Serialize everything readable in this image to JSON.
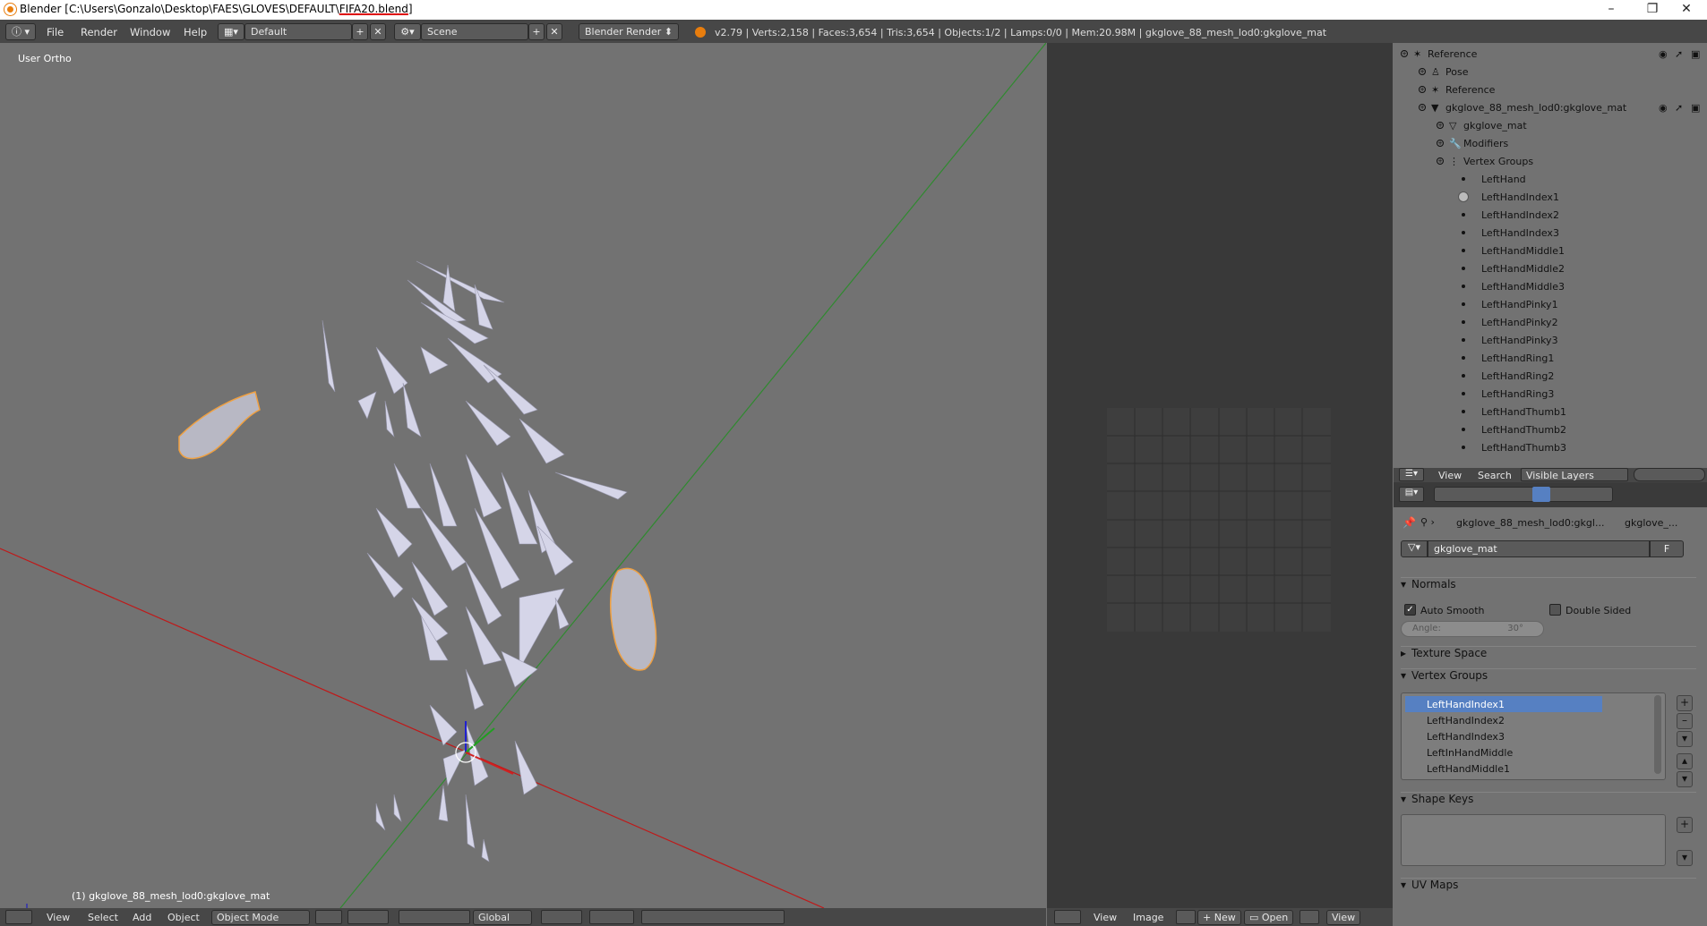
{
  "window": {
    "title_prefix": "Blender [C:\\Users\\Gonzalo\\Desktop\\FAES\\GLOVES\\DEFAULT\\",
    "title_file": "FIFA20.blend",
    "title_suffix": "]",
    "minimize": "–",
    "restore": "❐",
    "close": "✕"
  },
  "menubar": {
    "items": [
      "File",
      "Render",
      "Window",
      "Help"
    ],
    "layout": "Default",
    "scene": "Scene",
    "engine": "Blender Render",
    "stats": "v2.79 | Verts:2,158 | Faces:3,654 | Tris:3,654 | Objects:1/2 | Lamps:0/0 | Mem:20.98M | gkglove_88_mesh_lod0:gkglove_mat"
  },
  "viewport": {
    "view_name": "User Ortho",
    "object_label": "(1) gkglove_88_mesh_lod0:gkglove_mat",
    "axis_x": "X",
    "axis_y": "Y",
    "axis_z": "Z"
  },
  "outliner": {
    "rows": [
      {
        "label": "Reference",
        "indent": 0,
        "kind": "armature"
      },
      {
        "label": "Pose",
        "indent": 1,
        "kind": "pose"
      },
      {
        "label": "Reference",
        "indent": 1,
        "kind": "armdata"
      },
      {
        "label": "gkglove_88_mesh_lod0:gkglove_mat",
        "indent": 1,
        "kind": "mesh"
      },
      {
        "label": "gkglove_mat",
        "indent": 2,
        "kind": "meshdata"
      },
      {
        "label": "Modifiers",
        "indent": 2,
        "kind": "modifier"
      },
      {
        "label": "Vertex Groups",
        "indent": 2,
        "kind": "vgroups"
      },
      {
        "label": "LeftHand",
        "indent": 3,
        "kind": "vg"
      },
      {
        "label": "LeftHandIndex1",
        "indent": 3,
        "kind": "vg-active"
      },
      {
        "label": "LeftHandIndex2",
        "indent": 3,
        "kind": "vg"
      },
      {
        "label": "LeftHandIndex3",
        "indent": 3,
        "kind": "vg"
      },
      {
        "label": "LeftHandMiddle1",
        "indent": 3,
        "kind": "vg"
      },
      {
        "label": "LeftHandMiddle2",
        "indent": 3,
        "kind": "vg"
      },
      {
        "label": "LeftHandMiddle3",
        "indent": 3,
        "kind": "vg"
      },
      {
        "label": "LeftHandPinky1",
        "indent": 3,
        "kind": "vg"
      },
      {
        "label": "LeftHandPinky2",
        "indent": 3,
        "kind": "vg"
      },
      {
        "label": "LeftHandPinky3",
        "indent": 3,
        "kind": "vg"
      },
      {
        "label": "LeftHandRing1",
        "indent": 3,
        "kind": "vg"
      },
      {
        "label": "LeftHandRing2",
        "indent": 3,
        "kind": "vg"
      },
      {
        "label": "LeftHandRing3",
        "indent": 3,
        "kind": "vg"
      },
      {
        "label": "LeftHandThumb1",
        "indent": 3,
        "kind": "vg"
      },
      {
        "label": "LeftHandThumb2",
        "indent": 3,
        "kind": "vg"
      },
      {
        "label": "LeftHandThumb3",
        "indent": 3,
        "kind": "vg"
      }
    ],
    "header": {
      "view": "View",
      "search": "Search",
      "filter": "Visible Layers"
    }
  },
  "properties": {
    "breadcrumb_object": "gkglove_88_mesh_lod0:gkgl...",
    "breadcrumb_data": "gkglove_...",
    "datablock_name": "gkglove_mat",
    "fake_user": "F",
    "normals": {
      "title": "Normals",
      "auto_smooth": "Auto Smooth",
      "double_sided": "Double Sided",
      "angle_label": "Angle:",
      "angle_value": "30°"
    },
    "texture_space": "Texture Space",
    "vertex_groups": {
      "title": "Vertex Groups",
      "items": [
        "LeftHandIndex1",
        "LeftHandIndex2",
        "LeftHandIndex3",
        "LeftInHandMiddle",
        "LeftHandMiddle1"
      ],
      "selected": 0
    },
    "shape_keys": "Shape Keys",
    "uv_maps": "UV Maps"
  },
  "viewport_footer": {
    "items": [
      "View",
      "Select",
      "Add",
      "Object"
    ],
    "mode": "Object Mode",
    "orientation": "Global"
  },
  "image_footer": {
    "items": [
      "View",
      "Image"
    ],
    "new": "New",
    "open": "Open",
    "view": "View"
  },
  "colors": {
    "accent_select": "#5680c2",
    "outline_orange": "#f0a040",
    "axis_red": "#c01818",
    "axis_green": "#2f8a2f"
  }
}
